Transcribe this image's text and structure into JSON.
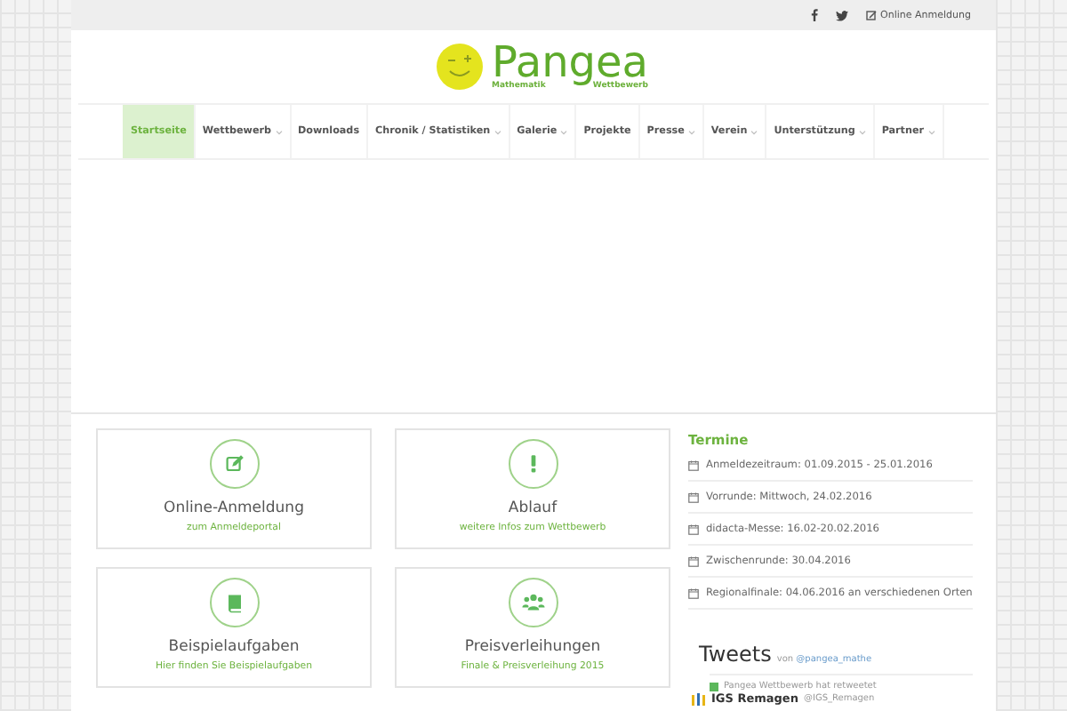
{
  "topbar": {
    "login": "Online Anmeldung"
  },
  "logo": {
    "title": "Pangea",
    "subtitle_left": "Mathematik",
    "subtitle_right": "Wettbewerb"
  },
  "nav": [
    {
      "label": "Startseite",
      "selected": true,
      "dropdown": false
    },
    {
      "label": "Wettbewerb",
      "selected": false,
      "dropdown": true
    },
    {
      "label": "Downloads",
      "selected": false,
      "dropdown": false
    },
    {
      "label": "Chronik / Statistiken",
      "selected": false,
      "dropdown": true
    },
    {
      "label": "Galerie",
      "selected": false,
      "dropdown": true
    },
    {
      "label": "Projekte",
      "selected": false,
      "dropdown": false
    },
    {
      "label": "Presse",
      "selected": false,
      "dropdown": true
    },
    {
      "label": "Verein",
      "selected": false,
      "dropdown": true
    },
    {
      "label": "Unterstützung",
      "selected": false,
      "dropdown": true
    },
    {
      "label": "Partner",
      "selected": false,
      "dropdown": true
    }
  ],
  "cards": [
    {
      "kind": "edit",
      "title": "Online-Anmeldung",
      "link": "zum Anmeldeportal"
    },
    {
      "kind": "exclamation",
      "title": "Ablauf",
      "link": "weitere Infos zum Wettbewerb"
    },
    {
      "kind": "book",
      "title": "Beispielaufgaben",
      "link": "Hier finden Sie Beispielaufgaben"
    },
    {
      "kind": "group",
      "title": "Preisverleihungen",
      "link": "Finale & Preisverleihung 2015"
    }
  ],
  "termine": {
    "title": "Termine",
    "items": [
      "Anmeldezeitraum: 01.09.2015 - 25.01.2016",
      "Vorrunde: Mittwoch, 24.02.2016",
      "didacta-Messe: 16.02-20.02.2016",
      "Zwischenrunde: 30.04.2016",
      "Regionalfinale: 04.06.2016 an verschiedenen Orten"
    ]
  },
  "tweets": {
    "title": "Tweets",
    "by": "von",
    "handle": "@pangea_mathe",
    "retweet": "Pangea Wettbewerb hat retweetet",
    "author": "IGS Remagen",
    "author_handle": "@IGS_Remagen"
  }
}
